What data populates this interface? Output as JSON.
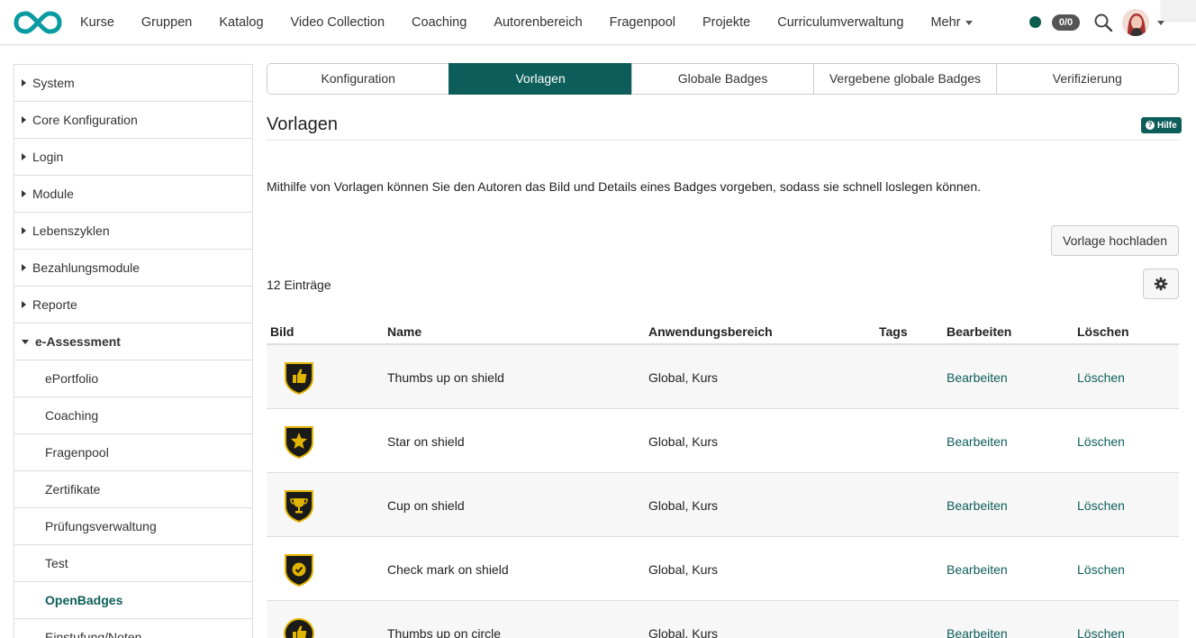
{
  "nav": {
    "items": [
      "Kurse",
      "Gruppen",
      "Katalog",
      "Video Collection",
      "Coaching",
      "Autorenbereich",
      "Fragenpool",
      "Projekte",
      "Curriculumverwaltung"
    ],
    "more_label": "Mehr",
    "counter": "0/0",
    "status_color": "#0d5e4f"
  },
  "sidebar": {
    "items": [
      {
        "label": "System"
      },
      {
        "label": "Core Konfiguration"
      },
      {
        "label": "Login"
      },
      {
        "label": "Module"
      },
      {
        "label": "Lebenszyklen"
      },
      {
        "label": "Bezahlungsmodule"
      },
      {
        "label": "Reporte"
      },
      {
        "label": "e-Assessment"
      }
    ],
    "subitems": [
      {
        "label": "ePortfolio"
      },
      {
        "label": "Coaching"
      },
      {
        "label": "Fragenpool"
      },
      {
        "label": "Zertifikate"
      },
      {
        "label": "Prüfungsverwaltung"
      },
      {
        "label": "Test"
      },
      {
        "label": "OpenBadges"
      },
      {
        "label": "Einstufung/Noten"
      }
    ]
  },
  "tabs": [
    {
      "label": "Konfiguration"
    },
    {
      "label": "Vorlagen"
    },
    {
      "label": "Globale Badges"
    },
    {
      "label": "Vergebene globale Badges"
    },
    {
      "label": "Verifizierung"
    }
  ],
  "main": {
    "title": "Vorlagen",
    "help_label": "Hilfe",
    "intro": "Mithilfe von Vorlagen können Sie den Autoren das Bild und Details eines Badges vorgeben, sodass sie schnell loslegen können.",
    "upload_label": "Vorlage hochladen",
    "entries": "12 Einträge"
  },
  "table": {
    "headers": {
      "image": "Bild",
      "name": "Name",
      "scope": "Anwendungsbereich",
      "tags": "Tags",
      "edit": "Bearbeiten",
      "delete": "Löschen"
    },
    "rows": [
      {
        "name": "Thumbs up on shield",
        "scope": "Global, Kurs",
        "edit": "Bearbeiten",
        "delete": "Löschen",
        "icon": "thumbs-up-shield"
      },
      {
        "name": "Star on shield",
        "scope": "Global, Kurs",
        "edit": "Bearbeiten",
        "delete": "Löschen",
        "icon": "star-shield"
      },
      {
        "name": "Cup on shield",
        "scope": "Global, Kurs",
        "edit": "Bearbeiten",
        "delete": "Löschen",
        "icon": "cup-shield"
      },
      {
        "name": "Check mark on shield",
        "scope": "Global, Kurs",
        "edit": "Bearbeiten",
        "delete": "Löschen",
        "icon": "check-shield"
      },
      {
        "name": "Thumbs up on circle",
        "scope": "Global, Kurs",
        "edit": "Bearbeiten",
        "delete": "Löschen",
        "icon": "thumbs-up-circle"
      }
    ]
  },
  "colors": {
    "accent": "#0d5e5a",
    "badge_gold": "#e0b400",
    "badge_dark": "#1a1a1a"
  }
}
